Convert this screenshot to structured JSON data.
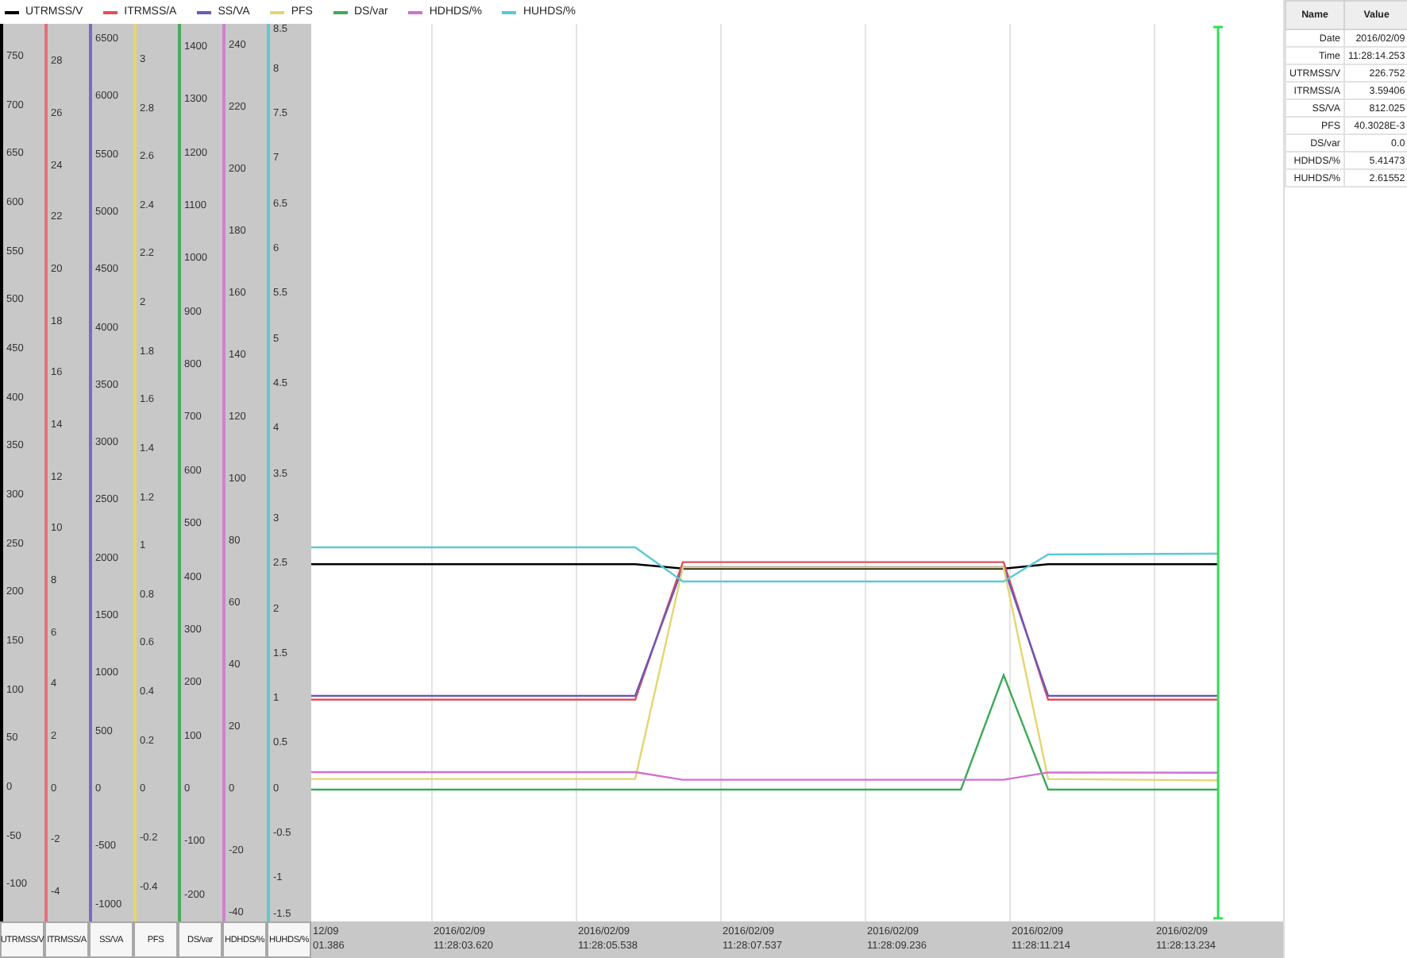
{
  "chart": {
    "legend": [
      {
        "name": "UTRMSS/V",
        "color": "#000000"
      },
      {
        "name": "ITRMSS/A",
        "color": "#e0505a"
      },
      {
        "name": "SS/VA",
        "color": "#6a5ab8"
      },
      {
        "name": "PFS",
        "color": "#e6d46e"
      },
      {
        "name": "DS/var",
        "color": "#3caa55"
      },
      {
        "name": "HDHDS/%",
        "color": "#d070d0"
      },
      {
        "name": "HUHDS/%",
        "color": "#5cc8d8"
      }
    ],
    "y_axes": [
      {
        "label": "UTRMSS/V",
        "color": "#000000",
        "ticks": [
          "750",
          "700",
          "650",
          "600",
          "550",
          "500",
          "450",
          "400",
          "350",
          "300",
          "250",
          "200",
          "150",
          "100",
          "50",
          "0",
          "-50",
          "-100"
        ]
      },
      {
        "label": "ITRMSS/A",
        "color": "#e0707a",
        "ticks": [
          "28",
          "26",
          "24",
          "22",
          "20",
          "18",
          "16",
          "14",
          "12",
          "10",
          "8",
          "6",
          "4",
          "2",
          "0",
          "-2",
          "-4"
        ]
      },
      {
        "label": "SS/VA",
        "color": "#7a6ac8",
        "ticks": [
          "6500",
          "6000",
          "5500",
          "5000",
          "4500",
          "4000",
          "3500",
          "3000",
          "2500",
          "2000",
          "1500",
          "1000",
          "500",
          "0",
          "-500",
          "-1000"
        ]
      },
      {
        "label": "PFS",
        "color": "#e6d46e",
        "ticks": [
          "3",
          "2.8",
          "2.6",
          "2.4",
          "2.2",
          "2",
          "1.8",
          "1.6",
          "1.4",
          "1.2",
          "1",
          "0.8",
          "0.6",
          "0.4",
          "0.2",
          "0",
          "-0.2",
          "-0.4"
        ]
      },
      {
        "label": "DS/var",
        "color": "#4caa60",
        "ticks": [
          "1400",
          "1300",
          "1200",
          "1100",
          "1000",
          "900",
          "800",
          "700",
          "600",
          "500",
          "400",
          "300",
          "200",
          "100",
          "0",
          "-100",
          "-200"
        ]
      },
      {
        "label": "HDHDS/%",
        "color": "#d080d0",
        "ticks": [
          "240",
          "220",
          "200",
          "180",
          "160",
          "140",
          "120",
          "100",
          "80",
          "60",
          "40",
          "20",
          "0",
          "-20",
          "-40"
        ]
      },
      {
        "label": "HUHDS/%",
        "color": "#60c8d0",
        "ticks": [
          "8.5",
          "8",
          "7.5",
          "7",
          "6.5",
          "6",
          "5.5",
          "5",
          "4.5",
          "4",
          "3.5",
          "3",
          "2.5",
          "2",
          "1.5",
          "1",
          "0.5",
          "0",
          "-0.5",
          "-1",
          "-1.5"
        ]
      }
    ],
    "x_axis_labels": [
      "12/09 01.386",
      "2016/02/09 11:28:03.620",
      "2016/02/09 11:28:05.538",
      "2016/02/09 11:28:07.537",
      "2016/02/09 11:28:09.236",
      "2016/02/09 11:28:11.214",
      "2016/02/09 11:28:13.234"
    ]
  },
  "value_table": {
    "columns": [
      "Name",
      "Value"
    ],
    "rows": [
      {
        "name": "Date",
        "value": "2016/02/09"
      },
      {
        "name": "Time",
        "value": "11:28:14.253"
      },
      {
        "name": "UTRMSS/V",
        "value": "226.752"
      },
      {
        "name": "ITRMSS/A",
        "value": "3.59406"
      },
      {
        "name": "SS/VA",
        "value": "812.025"
      },
      {
        "name": "PFS",
        "value": "40.3028E-3"
      },
      {
        "name": "DS/var",
        "value": "0.0"
      },
      {
        "name": "HDHDS/%",
        "value": "5.41473"
      },
      {
        "name": "HUHDS/%",
        "value": "2.61552"
      }
    ]
  }
}
